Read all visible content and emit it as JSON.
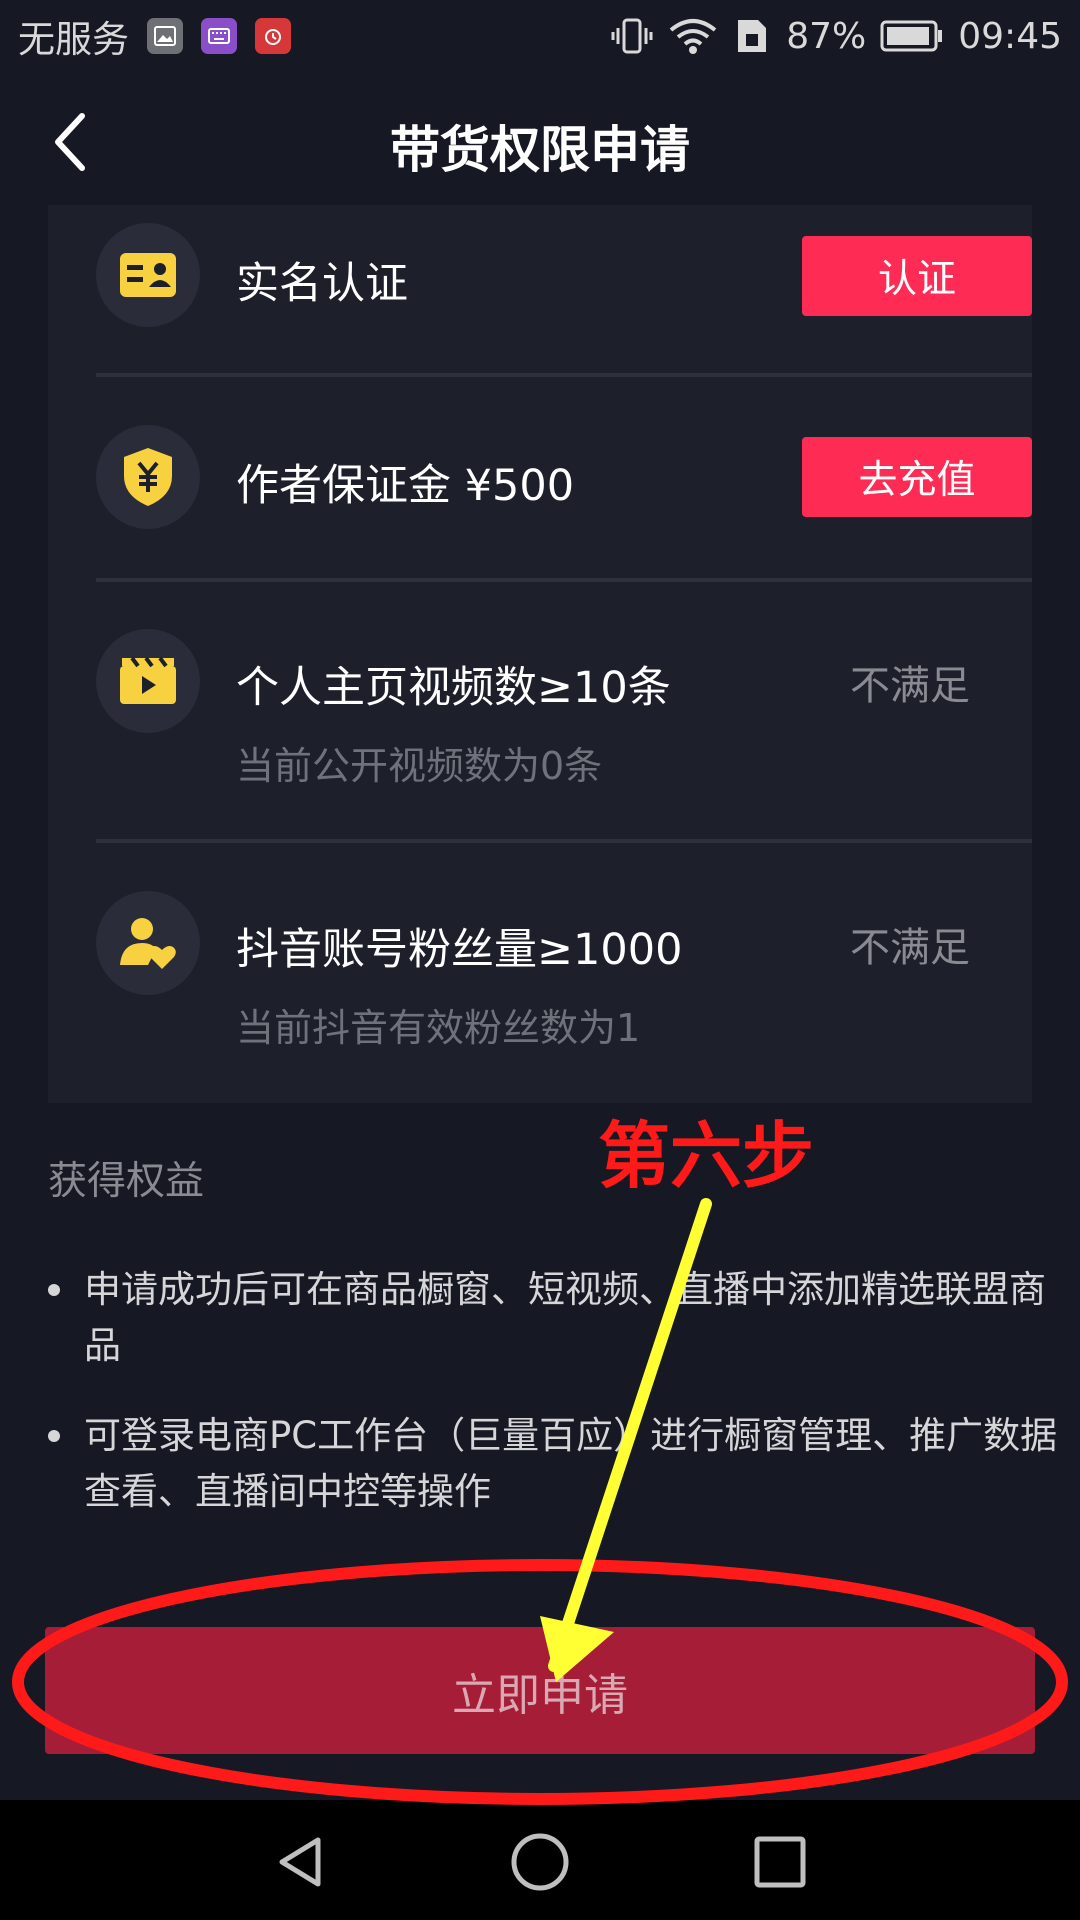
{
  "status_bar": {
    "carrier": "无服务",
    "battery": "87%",
    "time": "09:45"
  },
  "header": {
    "title": "带货权限申请"
  },
  "requirements": [
    {
      "title": "实名认证",
      "action": "认证"
    },
    {
      "title": "作者保证金 ¥500",
      "action": "去充值"
    },
    {
      "title": "个人主页视频数≥10条",
      "subtitle": "当前公开视频数为0条",
      "status": "不满足"
    },
    {
      "title": "抖音账号粉丝量≥1000",
      "subtitle": "当前抖音有效粉丝数为1",
      "status": "不满足"
    }
  ],
  "benefits": {
    "title": "获得权益",
    "items": [
      "申请成功后可在商品橱窗、短视频、直播中添加精选联盟商品",
      "可登录电商PC工作台（巨量百应）进行橱窗管理、推广数据查看、直播间中控等操作"
    ]
  },
  "apply_button": "立即申请",
  "annotation": {
    "label": "第六步"
  },
  "colors": {
    "background": "#161823",
    "card": "#1d202b",
    "accent": "#fe2c55",
    "apply_disabled": "#a61d37",
    "annotation_red": "#ff1a1a",
    "annotation_yellow": "#ffff33"
  }
}
